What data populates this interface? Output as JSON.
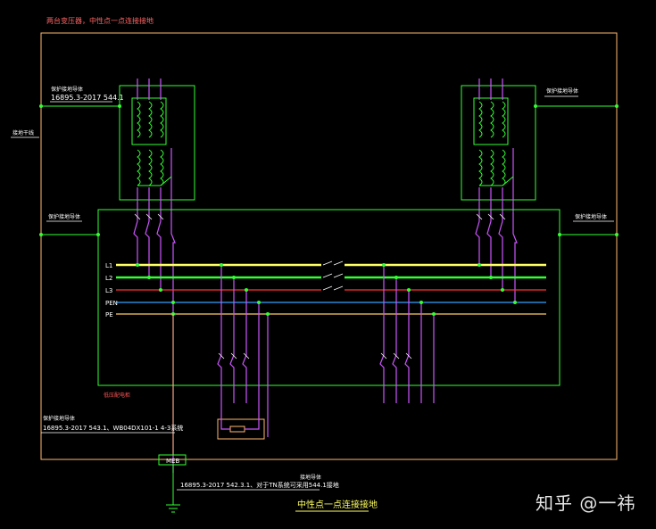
{
  "title": "两台变压器，中性点一点连接接地",
  "labels": {
    "prot_conductor_tl": "保护接地导体",
    "std_tl": "16895.3-2017 544.1",
    "prot_conductor_tr": "保护接地导体",
    "earth_main": "接地干线",
    "prot_conductor_ml": "保护接地导体",
    "prot_conductor_mr": "保护接地导体",
    "lv_panel": "低压配电柜",
    "prot_conductor_bl": "保护接地导体",
    "std_bl": "16895.3-2017 543.1、WB04DX101-1 4-3系统",
    "meb": "MEB",
    "earth_conductor": "接地导体",
    "std_bottom": "16895.3-2017 542.3.1、对于TN系统可采用544.1接地",
    "caption": "中性点一点连接接地"
  },
  "busbars": [
    {
      "name": "L1",
      "color": "#ffff66"
    },
    {
      "name": "L2",
      "color": "#33ff33"
    },
    {
      "name": "L3",
      "color": "#ff3333"
    },
    {
      "name": "PEN",
      "color": "#33a0ff"
    },
    {
      "name": "PE",
      "color": "#ffcc66"
    }
  ],
  "watermark": "知乎 @一祎",
  "colors": {
    "frame": "#ffb870",
    "equipment": "#33ff33",
    "conductor": "#cc55ff",
    "text_red": "#ff5555",
    "text_white": "#ffffff"
  }
}
